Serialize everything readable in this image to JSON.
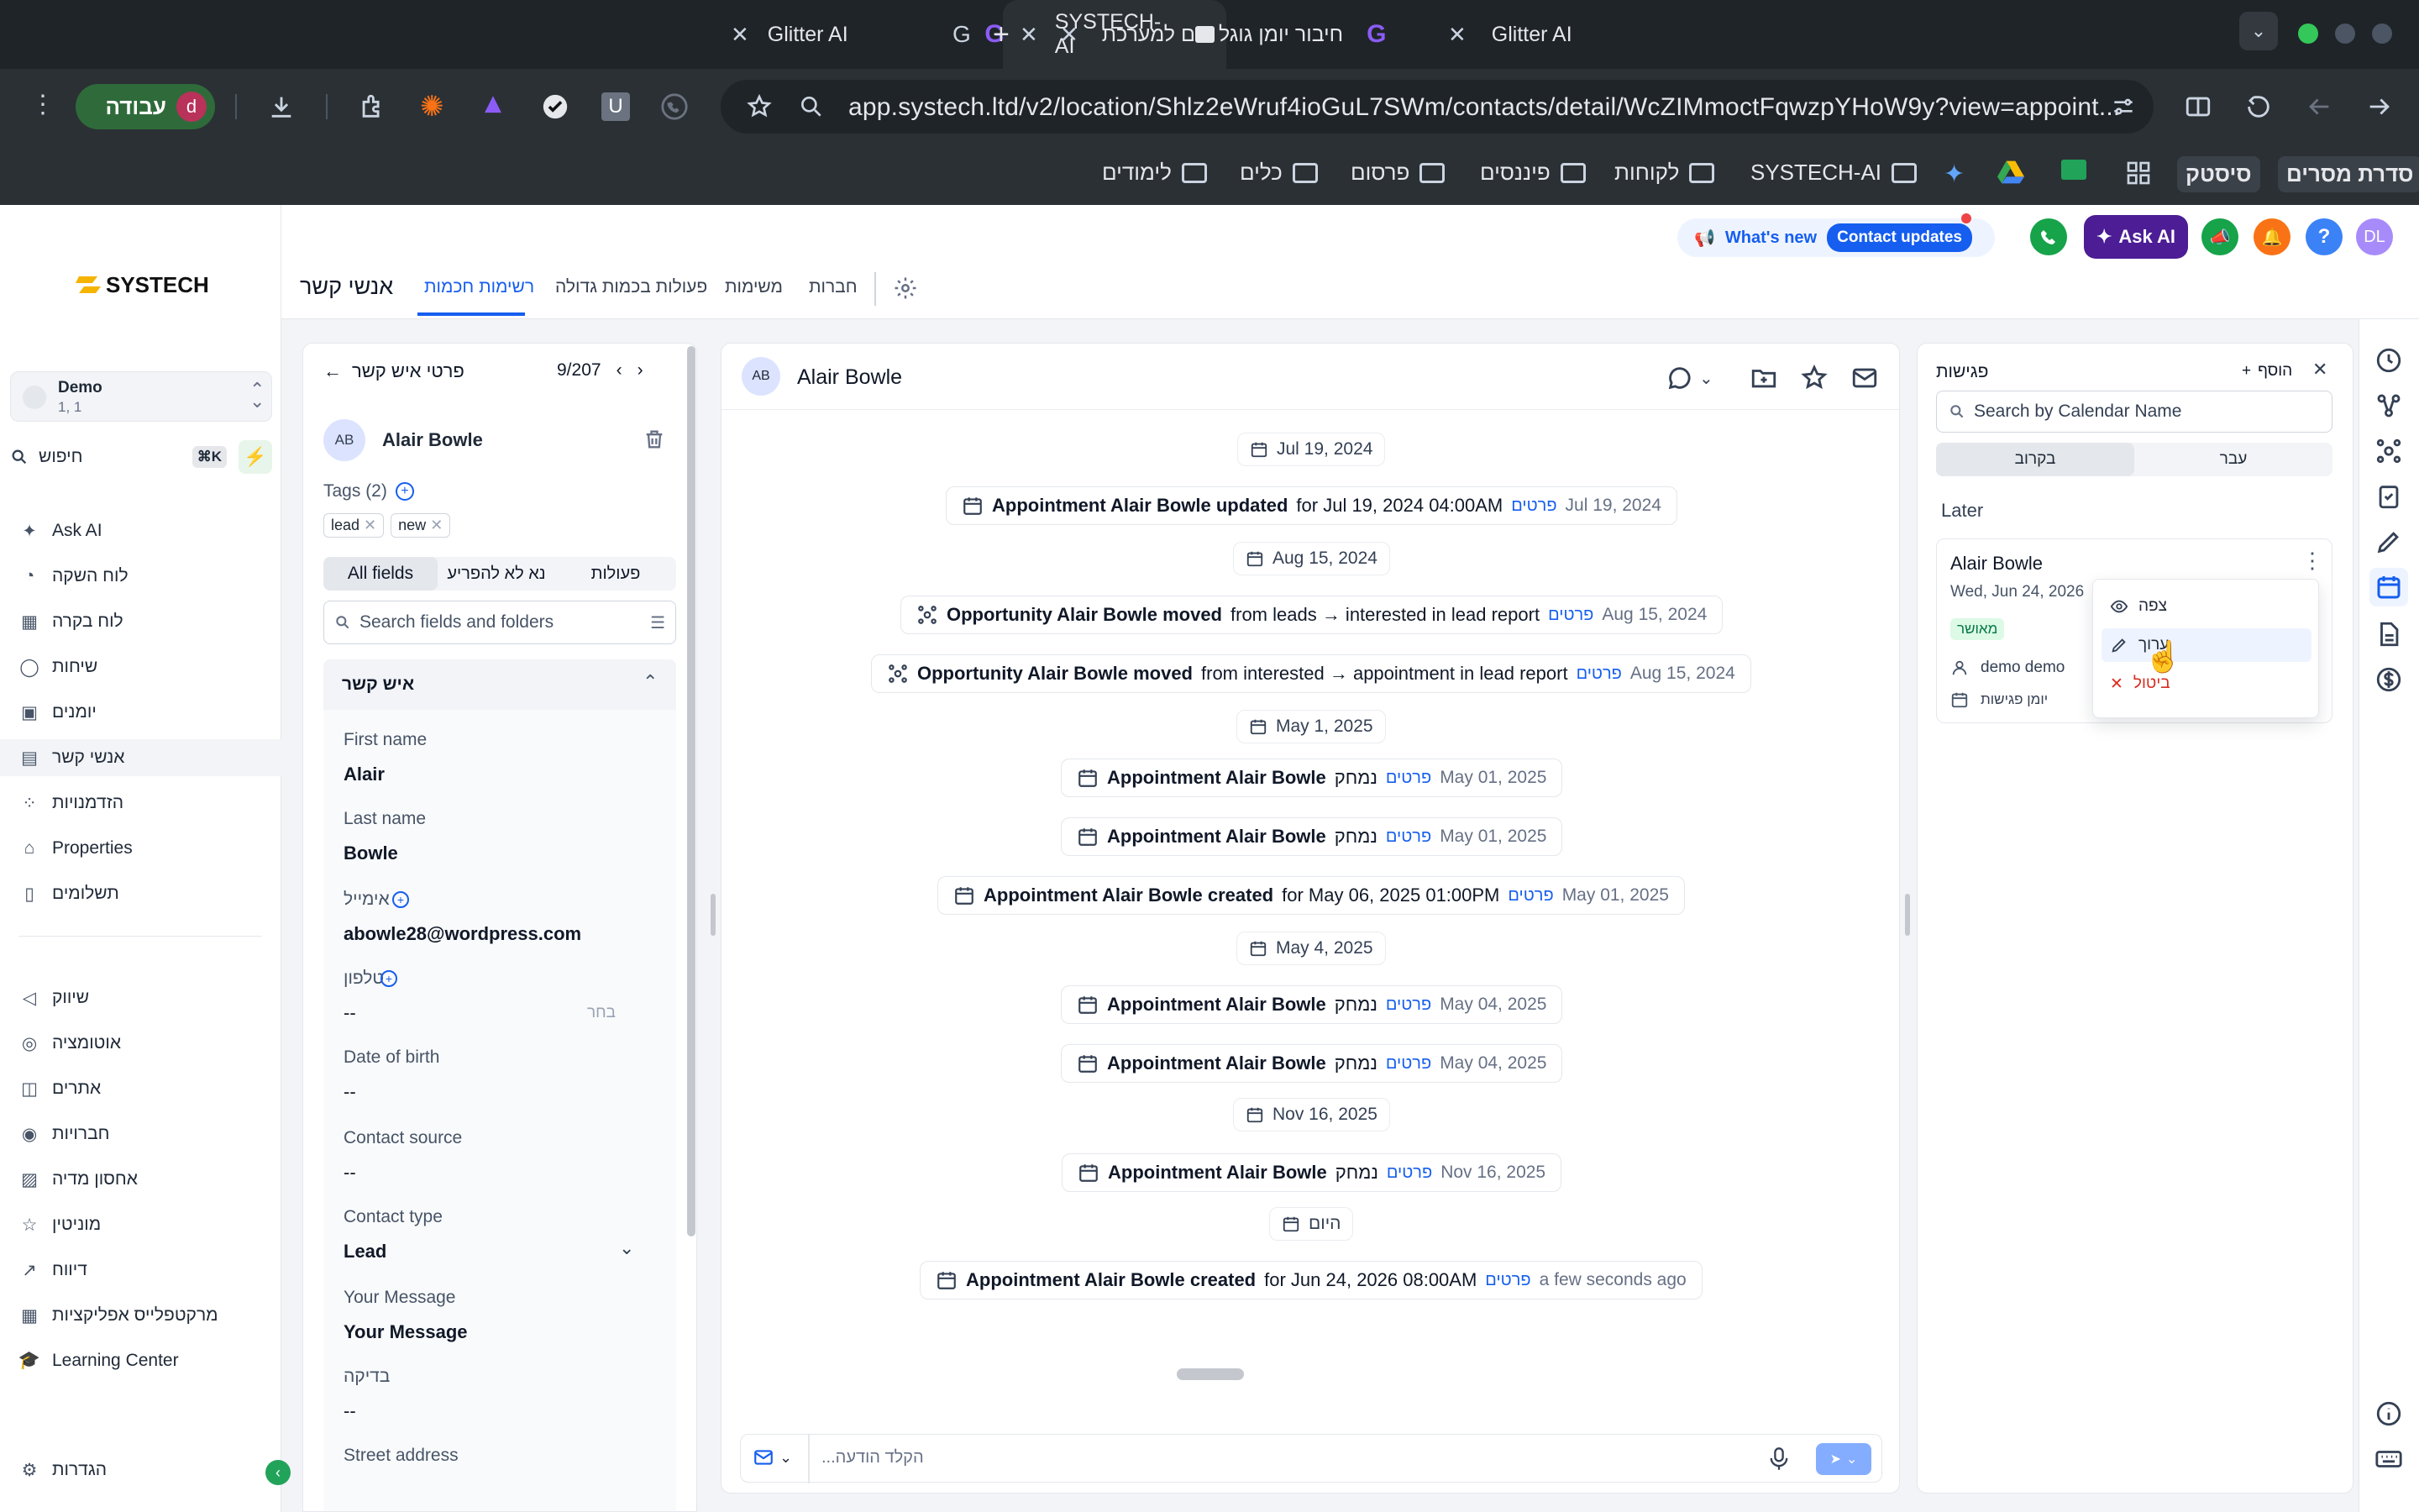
{
  "browser": {
    "tabs": [
      {
        "label": "SYSTECH-AI",
        "active": true
      },
      {
        "label": "Glitter AI",
        "active": false
      },
      {
        "label": "חיבור יומן גוגל וזום למערכת",
        "active": false
      }
    ],
    "url": "app.systech.ltd/v2/location/Shlz2eWruf4ioGuL7SWm/contacts/detail/WcZIMmoctFqwzpYHoW9y?view=appoint...",
    "profile_label": "עבודה",
    "profile_initial": "d",
    "bookmarks": [
      "סדרת מסרים",
      "סיסטק",
      "SYSTECH-AI",
      "לקוחות",
      "פיננסים",
      "פרסום",
      "כלים",
      "לימודים"
    ]
  },
  "sidebar": {
    "logo": "SYSTECH",
    "account": {
      "name": "Demo",
      "sub": "1, 1"
    },
    "search": {
      "placeholder": "חיפוש",
      "shortcut": "⌘K"
    },
    "items": [
      {
        "label": "Ask AI",
        "icon": "sparkle-icon"
      },
      {
        "label": "לוח השקה",
        "icon": "gauge-icon"
      },
      {
        "label": "לוח בקרה",
        "icon": "dashboard-icon"
      },
      {
        "label": "שיחות",
        "icon": "chat-icon"
      },
      {
        "label": "יומנים",
        "icon": "calendar-icon"
      },
      {
        "label": "אנשי קשר",
        "icon": "contacts-icon"
      },
      {
        "label": "הזדמנויות",
        "icon": "opportunities-icon"
      },
      {
        "label": "Properties",
        "icon": "home-icon"
      },
      {
        "label": "תשלומים",
        "icon": "payments-icon"
      }
    ],
    "items2": [
      {
        "label": "שיווק",
        "icon": "megaphone-icon"
      },
      {
        "label": "אוטומציה",
        "icon": "automation-icon"
      },
      {
        "label": "אתרים",
        "icon": "globe-icon"
      },
      {
        "label": "חברויות",
        "icon": "membership-icon"
      },
      {
        "label": "אחסון מדיה",
        "icon": "media-icon"
      },
      {
        "label": "מוניטין",
        "icon": "star-icon"
      },
      {
        "label": "דיווח",
        "icon": "chart-icon"
      },
      {
        "label": "מרקטפלייס אפליקציות",
        "icon": "apps-icon"
      },
      {
        "label": "Learning Center",
        "icon": "graduation-icon"
      }
    ],
    "settings": "הגדרות"
  },
  "topnav": {
    "title": "אנשי קשר",
    "tabs": [
      "רשימות חכמות",
      "פעולות בכמות גדולה",
      "משימות",
      "חברות"
    ],
    "whats_new": "What's new",
    "contact_updates": "Contact updates",
    "ask_ai": "Ask AI",
    "avatar": "DL"
  },
  "contact_panel": {
    "back_title": "פרטי איש קשר",
    "pager": "9/207",
    "avatar": "AB",
    "name": "Alair Bowle",
    "tags_label": "Tags (2)",
    "tags": [
      "lead",
      "new"
    ],
    "tabs": [
      "All fields",
      "נא לא להפריע",
      "פעולות"
    ],
    "search_placeholder": "Search fields and folders",
    "section": "איש קשר",
    "fields": [
      {
        "label": "First name",
        "value": "Alair"
      },
      {
        "label": "Last name",
        "value": "Bowle"
      },
      {
        "label": "אימייל",
        "value": "abowle28@wordpress.com"
      },
      {
        "label": "טלפון",
        "value": "--",
        "hint": "בחר"
      },
      {
        "label": "Date of birth",
        "value": "--"
      },
      {
        "label": "Contact source",
        "value": "--"
      },
      {
        "label": "Contact type",
        "value": "Lead"
      },
      {
        "label": "Your Message",
        "value": "Your Message"
      },
      {
        "label": "בדיקה",
        "value": "--"
      },
      {
        "label": "Street address",
        "value": ""
      }
    ]
  },
  "timeline": {
    "avatar": "AB",
    "name": "Alair Bowle",
    "composer_placeholder": "...הקלד הודעה",
    "entries": [
      {
        "kind": "date",
        "text": "Jul 19, 2024"
      },
      {
        "kind": "item",
        "icon": "calendar-icon",
        "bold": "Appointment Alair Bowle updated",
        "rest": "for Jul 19, 2024 04:00AM",
        "link": "פרטים",
        "when": "Jul 19, 2024"
      },
      {
        "kind": "date",
        "text": "Aug 15, 2024"
      },
      {
        "kind": "item",
        "icon": "opportunity-icon",
        "bold": "Opportunity Alair Bowle moved",
        "rest": "from leads → interested in lead report",
        "link": "פרטים",
        "when": "Aug 15, 2024"
      },
      {
        "kind": "item",
        "icon": "opportunity-icon",
        "bold": "Opportunity Alair Bowle moved",
        "rest": "from interested → appointment in lead report",
        "link": "פרטים",
        "when": "Aug 15, 2024"
      },
      {
        "kind": "date",
        "text": "May 1, 2025"
      },
      {
        "kind": "item",
        "icon": "calendar-icon",
        "bold": "Appointment Alair Bowle",
        "rest": "נמחק",
        "link": "פרטים",
        "when": "May 01, 2025"
      },
      {
        "kind": "item",
        "icon": "calendar-icon",
        "bold": "Appointment Alair Bowle",
        "rest": "נמחק",
        "link": "פרטים",
        "when": "May 01, 2025"
      },
      {
        "kind": "item",
        "icon": "calendar-icon",
        "bold": "Appointment Alair Bowle created",
        "rest": "for May 06, 2025 01:00PM",
        "link": "פרטים",
        "when": "May 01, 2025"
      },
      {
        "kind": "date",
        "text": "May 4, 2025"
      },
      {
        "kind": "item",
        "icon": "calendar-icon",
        "bold": "Appointment Alair Bowle",
        "rest": "נמחק",
        "link": "פרטים",
        "when": "May 04, 2025"
      },
      {
        "kind": "item",
        "icon": "calendar-icon",
        "bold": "Appointment Alair Bowle",
        "rest": "נמחק",
        "link": "פרטים",
        "when": "May 04, 2025"
      },
      {
        "kind": "date",
        "text": "Nov 16, 2025"
      },
      {
        "kind": "item",
        "icon": "calendar-icon",
        "bold": "Appointment Alair Bowle",
        "rest": "נמחק",
        "link": "פרטים",
        "when": "Nov 16, 2025"
      },
      {
        "kind": "date",
        "text": "היום"
      },
      {
        "kind": "item",
        "icon": "calendar-icon",
        "bold": "Appointment Alair Bowle created",
        "rest": "for Jun 24, 2026 08:00AM",
        "link": "פרטים",
        "when": "a few seconds ago"
      }
    ]
  },
  "meetings": {
    "title": "פגישות",
    "add": "הוסף",
    "search_placeholder": "Search by Calendar Name",
    "tabs": [
      "בקרוב",
      "עבר"
    ],
    "section": "Later",
    "card": {
      "name": "Alair Bowle",
      "date": "Wed, Jun 24, 2026",
      "status": "מאושר",
      "owner": "demo demo",
      "calendar": "יומן פגישות"
    },
    "menu": [
      "צפה",
      "ערוך",
      "ביטול"
    ]
  }
}
